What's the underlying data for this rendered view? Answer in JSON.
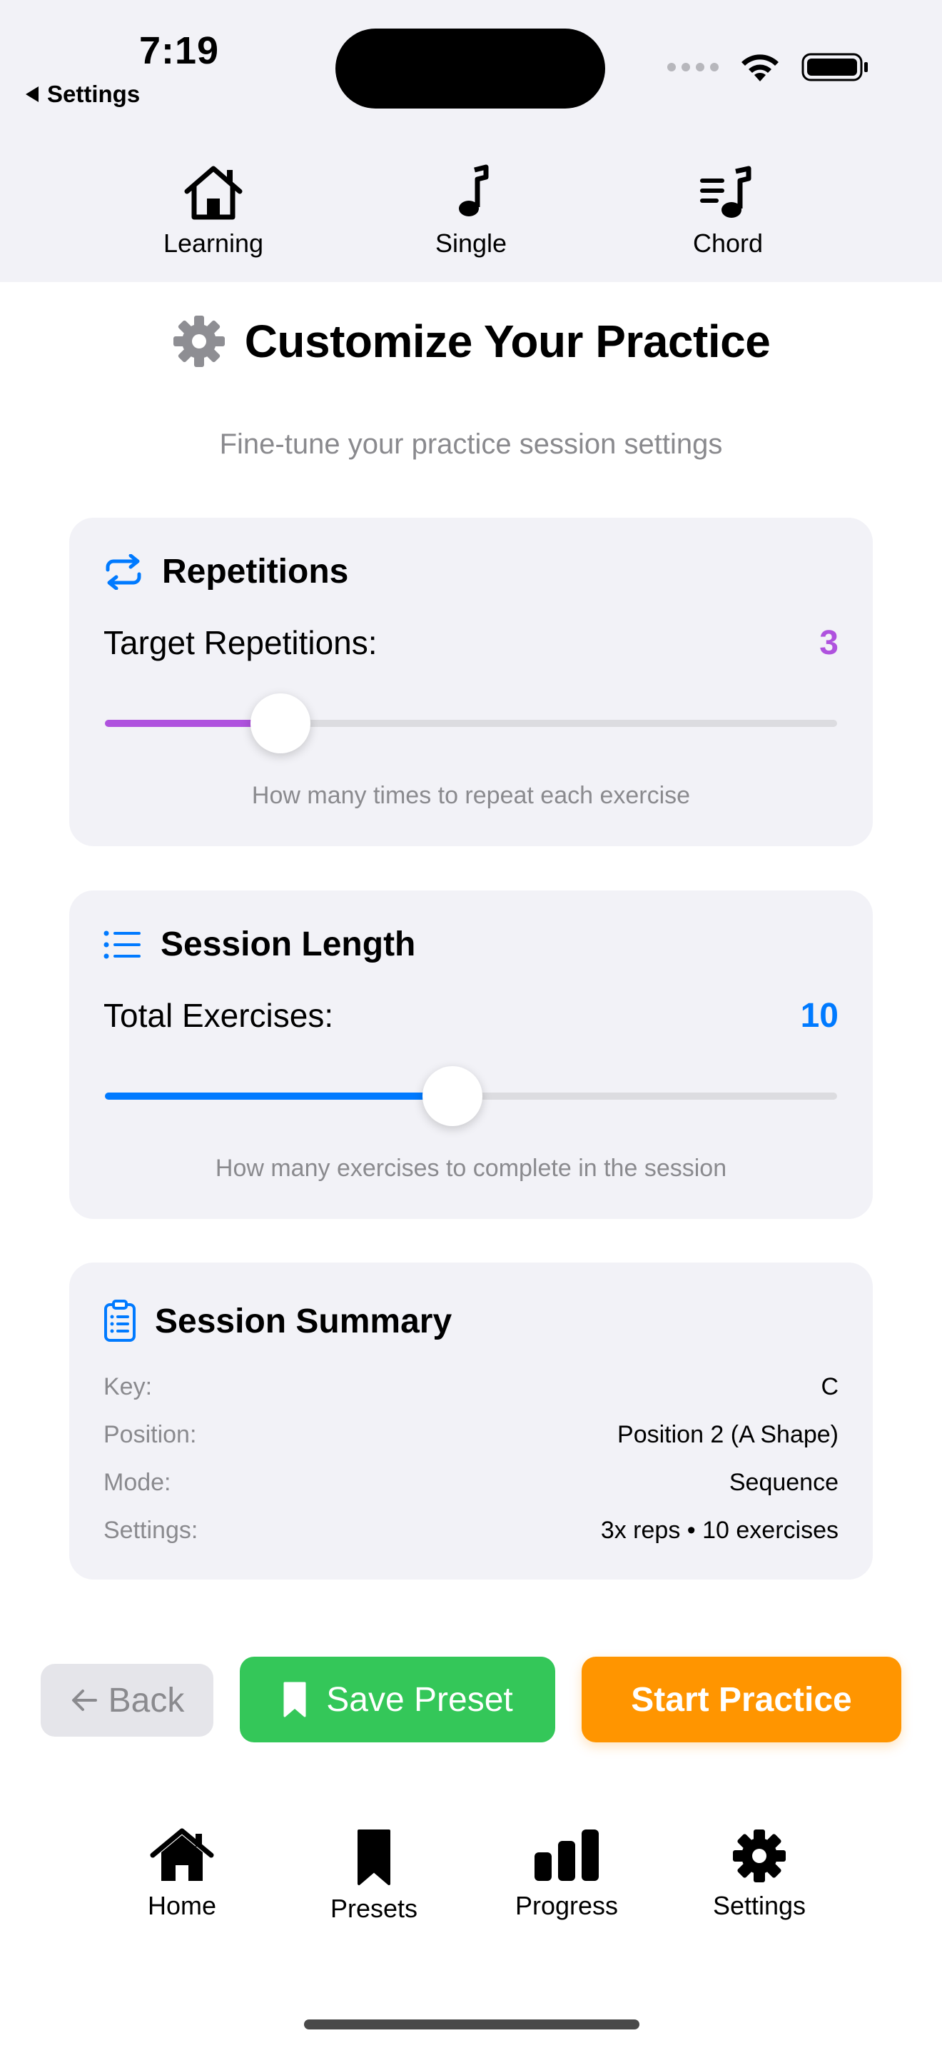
{
  "status_bar": {
    "time": "7:19",
    "back_app_label": "Settings"
  },
  "top_tabs": [
    {
      "label": "Learning",
      "icon": "house-outline-icon"
    },
    {
      "label": "Single",
      "icon": "music-note-icon"
    },
    {
      "label": "Chord",
      "icon": "note-list-icon"
    }
  ],
  "header": {
    "title": "Customize Your Practice",
    "subtitle": "Fine-tune your practice session settings",
    "icon": "gear-icon"
  },
  "repetitions": {
    "title": "Repetitions",
    "icon": "repeat-icon",
    "label": "Target Repetitions:",
    "value": "3",
    "slider_fraction": 0.24,
    "hint": "How many times to repeat each exercise",
    "accent": "#af52de"
  },
  "session_length": {
    "title": "Session Length",
    "icon": "list-icon",
    "label": "Total Exercises:",
    "value": "10",
    "slider_fraction": 0.475,
    "hint": "How many exercises to complete in the session",
    "accent": "#007aff"
  },
  "summary": {
    "title": "Session Summary",
    "icon": "clipboard-icon",
    "rows": [
      {
        "key": "Key:",
        "value": "C"
      },
      {
        "key": "Position:",
        "value": "Position 2 (A Shape)"
      },
      {
        "key": "Mode:",
        "value": "Sequence"
      },
      {
        "key": "Settings:",
        "value": "3x reps • 10 exercises"
      }
    ]
  },
  "actions": {
    "back": "Back",
    "save": "Save Preset",
    "start": "Start Practice"
  },
  "bottom_nav": [
    {
      "label": "Home",
      "icon": "house-icon"
    },
    {
      "label": "Presets",
      "icon": "bookmark-icon"
    },
    {
      "label": "Progress",
      "icon": "bar-chart-icon"
    },
    {
      "label": "Settings",
      "icon": "gear-icon"
    }
  ],
  "colors": {
    "purple": "#af52de",
    "blue": "#007aff",
    "green": "#34c759",
    "orange": "#ff9500"
  }
}
